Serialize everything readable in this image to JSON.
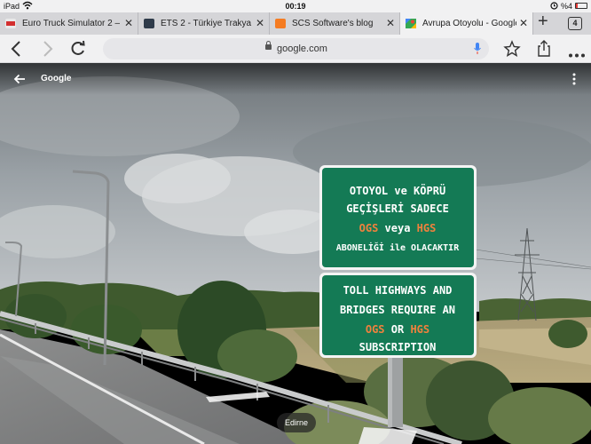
{
  "status_bar": {
    "device": "iPad",
    "time": "00:19",
    "battery": "%4"
  },
  "tabs": [
    {
      "label": "Euro Truck Simulator 2 –",
      "favicon_color": "#e0e0e0",
      "active": false
    },
    {
      "label": "ETS 2 - Türkiye Trakya \"R",
      "favicon_color": "#2f3b4a",
      "active": false
    },
    {
      "label": "SCS Software's blog",
      "favicon_color": "#f57c22",
      "active": false
    },
    {
      "label": "Avrupa Otoyolu - Google",
      "favicon_color": "#34a853",
      "active": true
    }
  ],
  "tab_count": "4",
  "toolbar": {
    "url": "google.com"
  },
  "street_view": {
    "title": "Google",
    "place_label": "Edirne"
  },
  "sign": {
    "turkish": {
      "line1": "OTOYOL ve KÖPRÜ",
      "line2": "GEÇİŞLERİ SADECE",
      "line3_a": "OGS",
      "line3_b": " veya ",
      "line3_c": "HGS",
      "line4": "ABONELİĞİ ile OLACAKTIR"
    },
    "english": {
      "line1": "TOLL HIGHWAYS AND",
      "line2": "BRIDGES REQUIRE AN",
      "line3_a": "OGS",
      "line3_b": " OR ",
      "line3_c": "HGS",
      "line4": "SUBSCRIPTION"
    },
    "colors": {
      "panel": "#147a55",
      "text": "#ffffff",
      "highlight": "#f0813d"
    }
  }
}
